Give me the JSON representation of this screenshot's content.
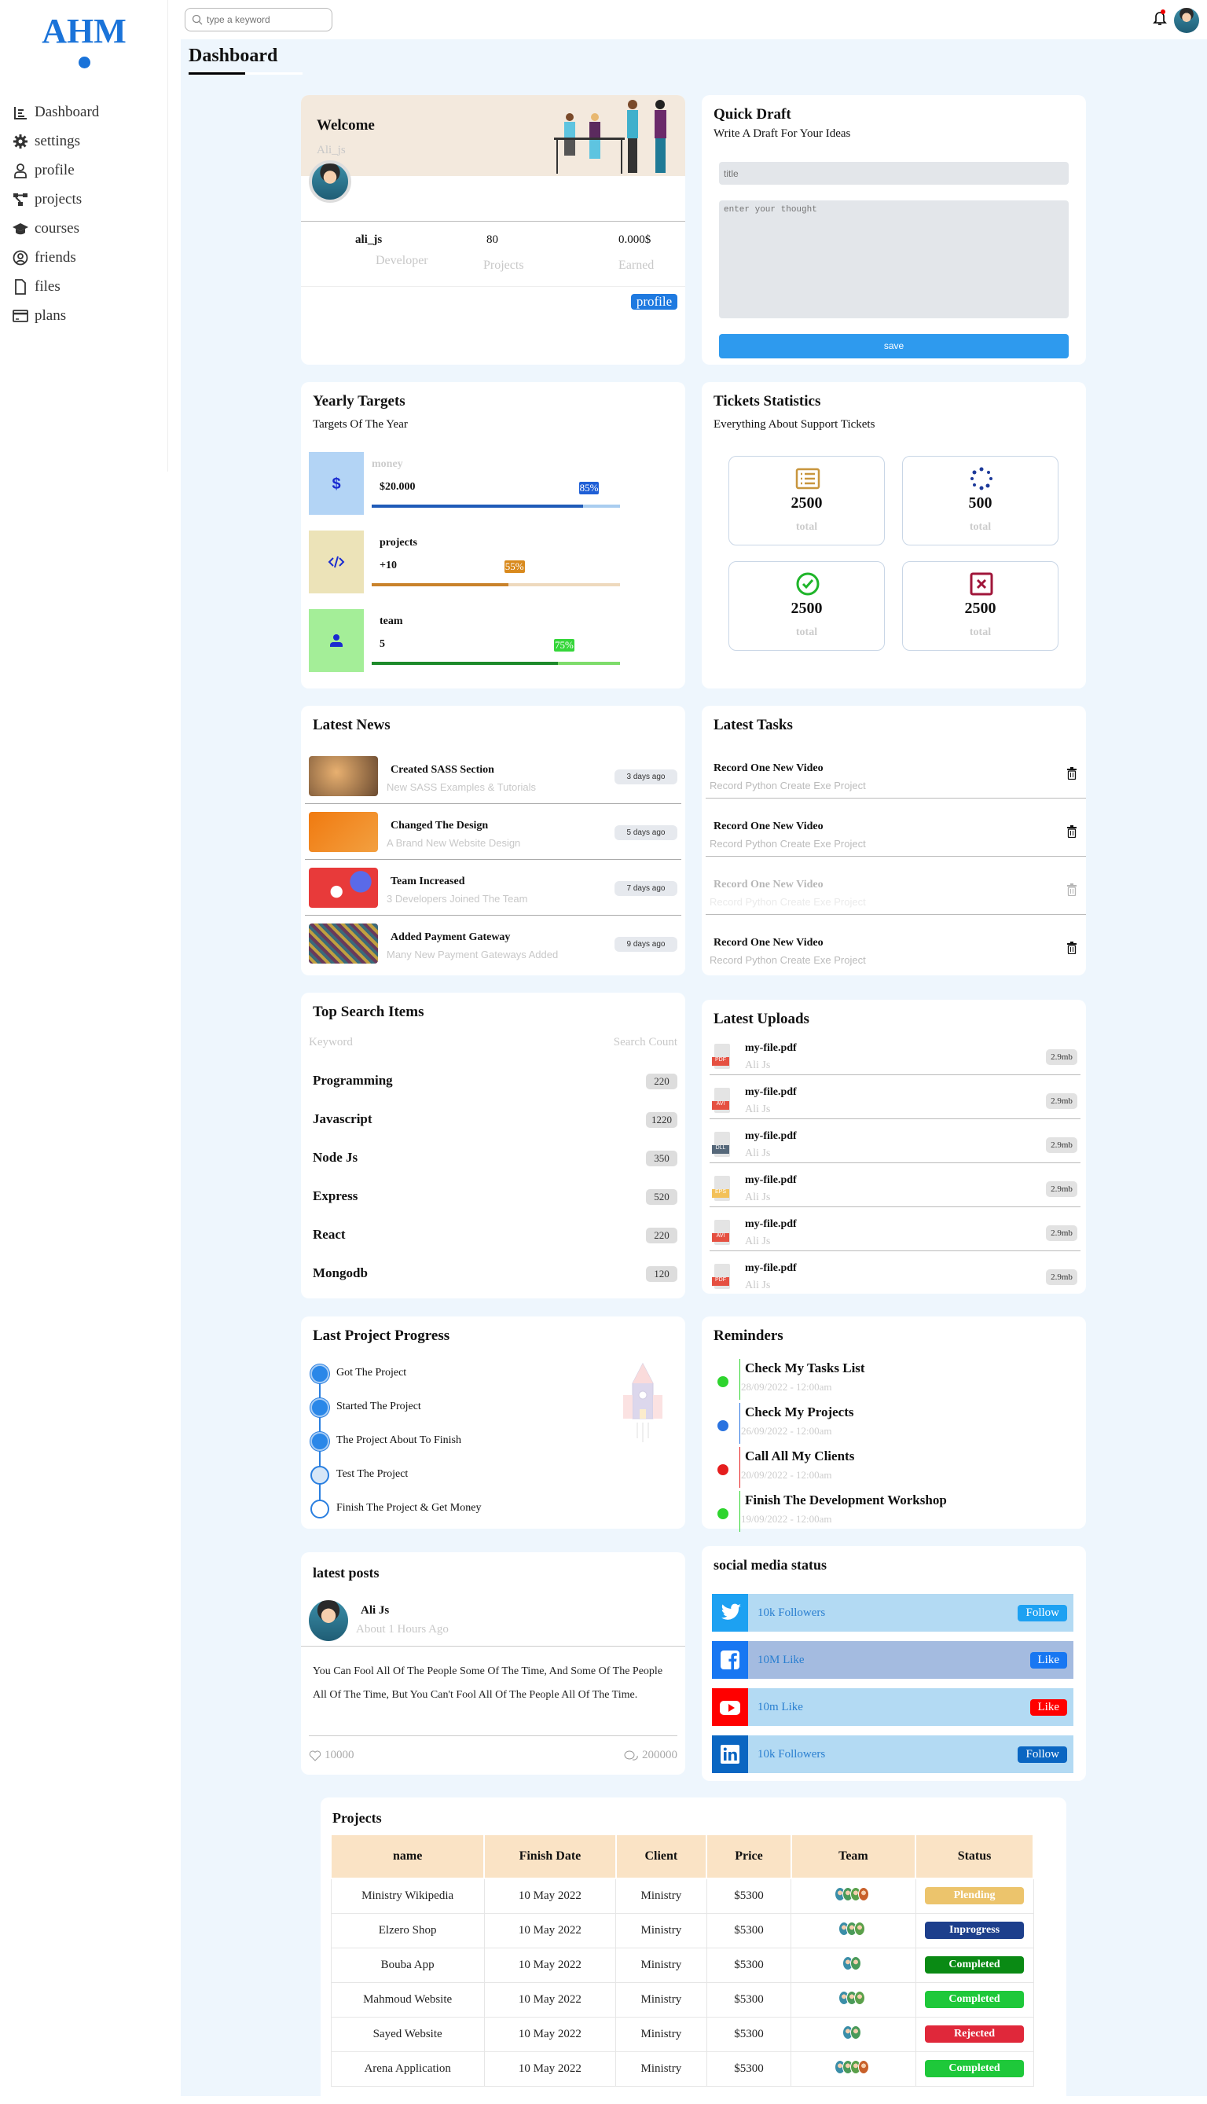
{
  "sidebar": {
    "logo": "AHM",
    "items": [
      {
        "label": "Dashboard",
        "icon": "dashboard-icon"
      },
      {
        "label": "settings",
        "icon": "gear-icon"
      },
      {
        "label": "profile",
        "icon": "user-icon"
      },
      {
        "label": "projects",
        "icon": "diagram-icon"
      },
      {
        "label": "courses",
        "icon": "graduation-cap-icon"
      },
      {
        "label": "friends",
        "icon": "user-circle-icon"
      },
      {
        "label": "files",
        "icon": "file-icon"
      },
      {
        "label": "plans",
        "icon": "credit-card-icon"
      }
    ]
  },
  "header": {
    "search_placeholder": "type a keyword"
  },
  "page": {
    "title": "Dashboard"
  },
  "welcome": {
    "title": "Welcome",
    "username": "Ali_js",
    "stats": [
      {
        "value": "ali_js",
        "label": "Developer"
      },
      {
        "value": "80",
        "label": "Projects"
      },
      {
        "value": "0.000$",
        "label": "Earned"
      }
    ],
    "profile_button": "profile"
  },
  "draft": {
    "title": "Quick Draft",
    "subtitle": "Write A Draft For Your Ideas",
    "title_placeholder": "title",
    "body_placeholder": "enter your thought",
    "save": "save"
  },
  "targets": {
    "title": "Yearly Targets",
    "subtitle": "Targets Of The Year",
    "items": [
      {
        "label": "money",
        "value": "$20.000",
        "percent": 85,
        "pct_label": "85%",
        "icon": "dollar-icon",
        "bg": "#b3d4f5",
        "bar": "#1f5bb8",
        "track": "#a9cdf0",
        "badge": "#1f5fd6"
      },
      {
        "label": "projects",
        "value": "+10",
        "percent": 55,
        "pct_label": "55%",
        "icon": "code-icon",
        "bg": "#ece3b8",
        "bar": "#c9822b",
        "track": "#eed9bd",
        "badge": "#d98a1e"
      },
      {
        "label": "team",
        "value": "5",
        "percent": 75,
        "pct_label": "75%",
        "icon": "user-icon",
        "bg": "#a4ee98",
        "bar": "#1d8a2a",
        "track": "#7ddc6a",
        "badge": "#35d63a"
      }
    ]
  },
  "tickets": {
    "title": "Tickets Statistics",
    "subtitle": "Everything About Support Tickets",
    "items": [
      {
        "value": "2500",
        "label": "total",
        "icon": "list-icon"
      },
      {
        "value": "500",
        "label": "total",
        "icon": "spinner-icon"
      },
      {
        "value": "2500",
        "label": "total",
        "icon": "check-circle-icon"
      },
      {
        "value": "2500",
        "label": "total",
        "icon": "x-square-icon"
      }
    ]
  },
  "news": {
    "title": "Latest News",
    "items": [
      {
        "title": "Created SASS Section",
        "desc": "New SASS Examples & Tutorials",
        "time": "3 days ago"
      },
      {
        "title": "Changed The Design",
        "desc": "A Brand New Website Design",
        "time": "5 days ago"
      },
      {
        "title": "Team Increased",
        "desc": "3 Developers Joined The Team",
        "time": "7 days ago"
      },
      {
        "title": "Added Payment Gateway",
        "desc": "Many New Payment Gateways Added",
        "time": "9 days ago"
      }
    ]
  },
  "tasks": {
    "title": "Latest Tasks",
    "items": [
      {
        "title": "Record One New Video",
        "desc": "Record Python Create Exe Project",
        "done": false
      },
      {
        "title": "Record One New Video",
        "desc": "Record Python Create Exe Project",
        "done": false
      },
      {
        "title": "Record One New Video",
        "desc": "Record Python Create Exe Project",
        "done": true
      },
      {
        "title": "Record One New Video",
        "desc": "Record Python Create Exe Project",
        "done": false
      }
    ]
  },
  "search_items": {
    "title": "Top Search Items",
    "col_keyword": "Keyword",
    "col_count": "Search Count",
    "items": [
      {
        "k": "Programming",
        "c": "220"
      },
      {
        "k": "Javascript",
        "c": "1220"
      },
      {
        "k": "Node Js",
        "c": "350"
      },
      {
        "k": "Express",
        "c": "520"
      },
      {
        "k": "React",
        "c": "220"
      },
      {
        "k": "Mongodb",
        "c": "120"
      }
    ]
  },
  "uploads": {
    "title": "Latest Uploads",
    "items": [
      {
        "name": "my-file.pdf",
        "by": "Ali Js",
        "size": "2.9mb",
        "type": "PDF",
        "color": "#e55041"
      },
      {
        "name": "my-file.pdf",
        "by": "Ali Js",
        "size": "2.9mb",
        "type": "AVI",
        "color": "#e55041"
      },
      {
        "name": "my-file.pdf",
        "by": "Ali Js",
        "size": "2.9mb",
        "type": "DLL",
        "color": "#56687a"
      },
      {
        "name": "my-file.pdf",
        "by": "Ali Js",
        "size": "2.9mb",
        "type": "EPS",
        "color": "#f3c15a"
      },
      {
        "name": "my-file.pdf",
        "by": "Ali Js",
        "size": "2.9mb",
        "type": "AVI",
        "color": "#e55041"
      },
      {
        "name": "my-file.pdf",
        "by": "Ali Js",
        "size": "2.9mb",
        "type": "PDF",
        "color": "#e55041"
      }
    ]
  },
  "progress": {
    "title": "Last Project Progress",
    "steps": [
      {
        "label": "Got The Project",
        "state": "done"
      },
      {
        "label": "Started The Project",
        "state": "done"
      },
      {
        "label": "The Project About To Finish",
        "state": "done"
      },
      {
        "label": "Test The Project",
        "state": "current"
      },
      {
        "label": "Finish The Project & Get Money",
        "state": "todo"
      }
    ]
  },
  "reminders": {
    "title": "Reminders",
    "items": [
      {
        "title": "Check My Tasks List",
        "date": "28/09/2022 - 12:00am",
        "color": "#2ed42e"
      },
      {
        "title": "Check My Projects",
        "date": "26/09/2022 - 12:00am",
        "color": "#2a73e0"
      },
      {
        "title": "Call All My Clients",
        "date": "20/09/2022 - 12:00am",
        "color": "#e51d1d"
      },
      {
        "title": "Finish The Development Workshop",
        "date": "19/09/2022 - 12:00am",
        "color": "#2ed42e"
      }
    ]
  },
  "posts": {
    "title": "latest posts",
    "author": "Ali Js",
    "time": "About 1 Hours Ago",
    "body": "You Can Fool All Of The People Some Of The Time, And Some Of The People All Of The Time, But You Can't Fool All Of The People All Of The Time.",
    "likes": "10000",
    "comments": "200000"
  },
  "social": {
    "title": "social media status",
    "items": [
      {
        "net": "twitter",
        "label": "10k Followers",
        "button": "Follow",
        "icon_bg": "#1da1f2",
        "row_bg": "#b3daf3",
        "btn_bg": "#1da1f2"
      },
      {
        "net": "facebook",
        "label": "10M Like",
        "button": "Like",
        "icon_bg": "#1877f2",
        "row_bg": "#a4bbe0",
        "btn_bg": "#1877f2"
      },
      {
        "net": "youtube",
        "label": "10m Like",
        "button": "Like",
        "icon_bg": "#f00",
        "row_bg": "#b3daf3",
        "btn_bg": "#f00"
      },
      {
        "net": "linkedin",
        "label": "10k Followers",
        "button": "Follow",
        "icon_bg": "#0a66c2",
        "row_bg": "#b3daf3",
        "btn_bg": "#0a66c2"
      }
    ]
  },
  "projects": {
    "title": "Projects",
    "columns": [
      "name",
      "Finish Date",
      "Client",
      "Price",
      "Team",
      "Status"
    ],
    "rows": [
      {
        "name": "Ministry Wikipedia",
        "date": "10 May 2022",
        "client": "Ministry",
        "price": "$5300",
        "team": 4,
        "status": "Plending",
        "color": "#ecc46c"
      },
      {
        "name": "Elzero Shop",
        "date": "10 May 2022",
        "client": "Ministry",
        "price": "$5300",
        "team": 3,
        "status": "Inprogress",
        "color": "#1d3f8c"
      },
      {
        "name": "Bouba App",
        "date": "10 May 2022",
        "client": "Ministry",
        "price": "$5300",
        "team": 2,
        "status": "Completed",
        "color": "#0a8a14"
      },
      {
        "name": "Mahmoud Website",
        "date": "10 May 2022",
        "client": "Ministry",
        "price": "$5300",
        "team": 3,
        "status": "Completed",
        "color": "#1ec83a"
      },
      {
        "name": "Sayed Website",
        "date": "10 May 2022",
        "client": "Ministry",
        "price": "$5300",
        "team": 2,
        "status": "Rejected",
        "color": "#e0283a"
      },
      {
        "name": "Arena Application",
        "date": "10 May 2022",
        "client": "Ministry",
        "price": "$5300",
        "team": 4,
        "status": "Completed",
        "color": "#1ec83a"
      }
    ]
  }
}
